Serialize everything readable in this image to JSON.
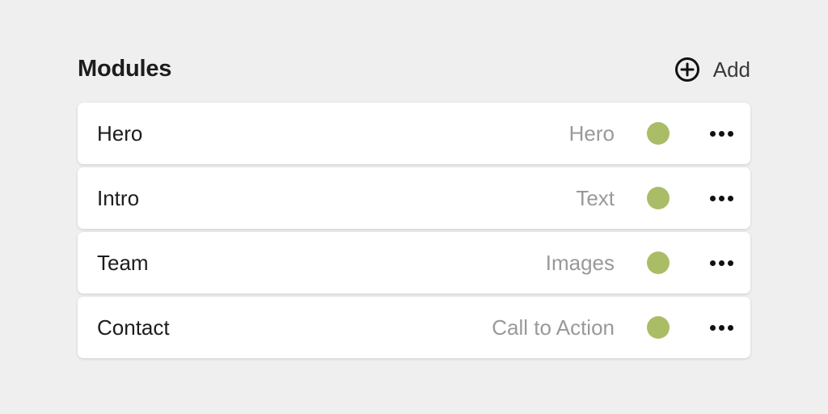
{
  "header": {
    "title": "Modules",
    "add_label": "Add"
  },
  "colors": {
    "status_active": "#a9bd66",
    "background": "#efefef"
  },
  "icons": {
    "add": "plus-circle-icon",
    "more": "more-horizontal-icon"
  },
  "modules": [
    {
      "name": "Hero",
      "type": "Hero",
      "status": "active"
    },
    {
      "name": "Intro",
      "type": "Text",
      "status": "active"
    },
    {
      "name": "Team",
      "type": "Images",
      "status": "active"
    },
    {
      "name": "Contact",
      "type": "Call to Action",
      "status": "active"
    }
  ]
}
